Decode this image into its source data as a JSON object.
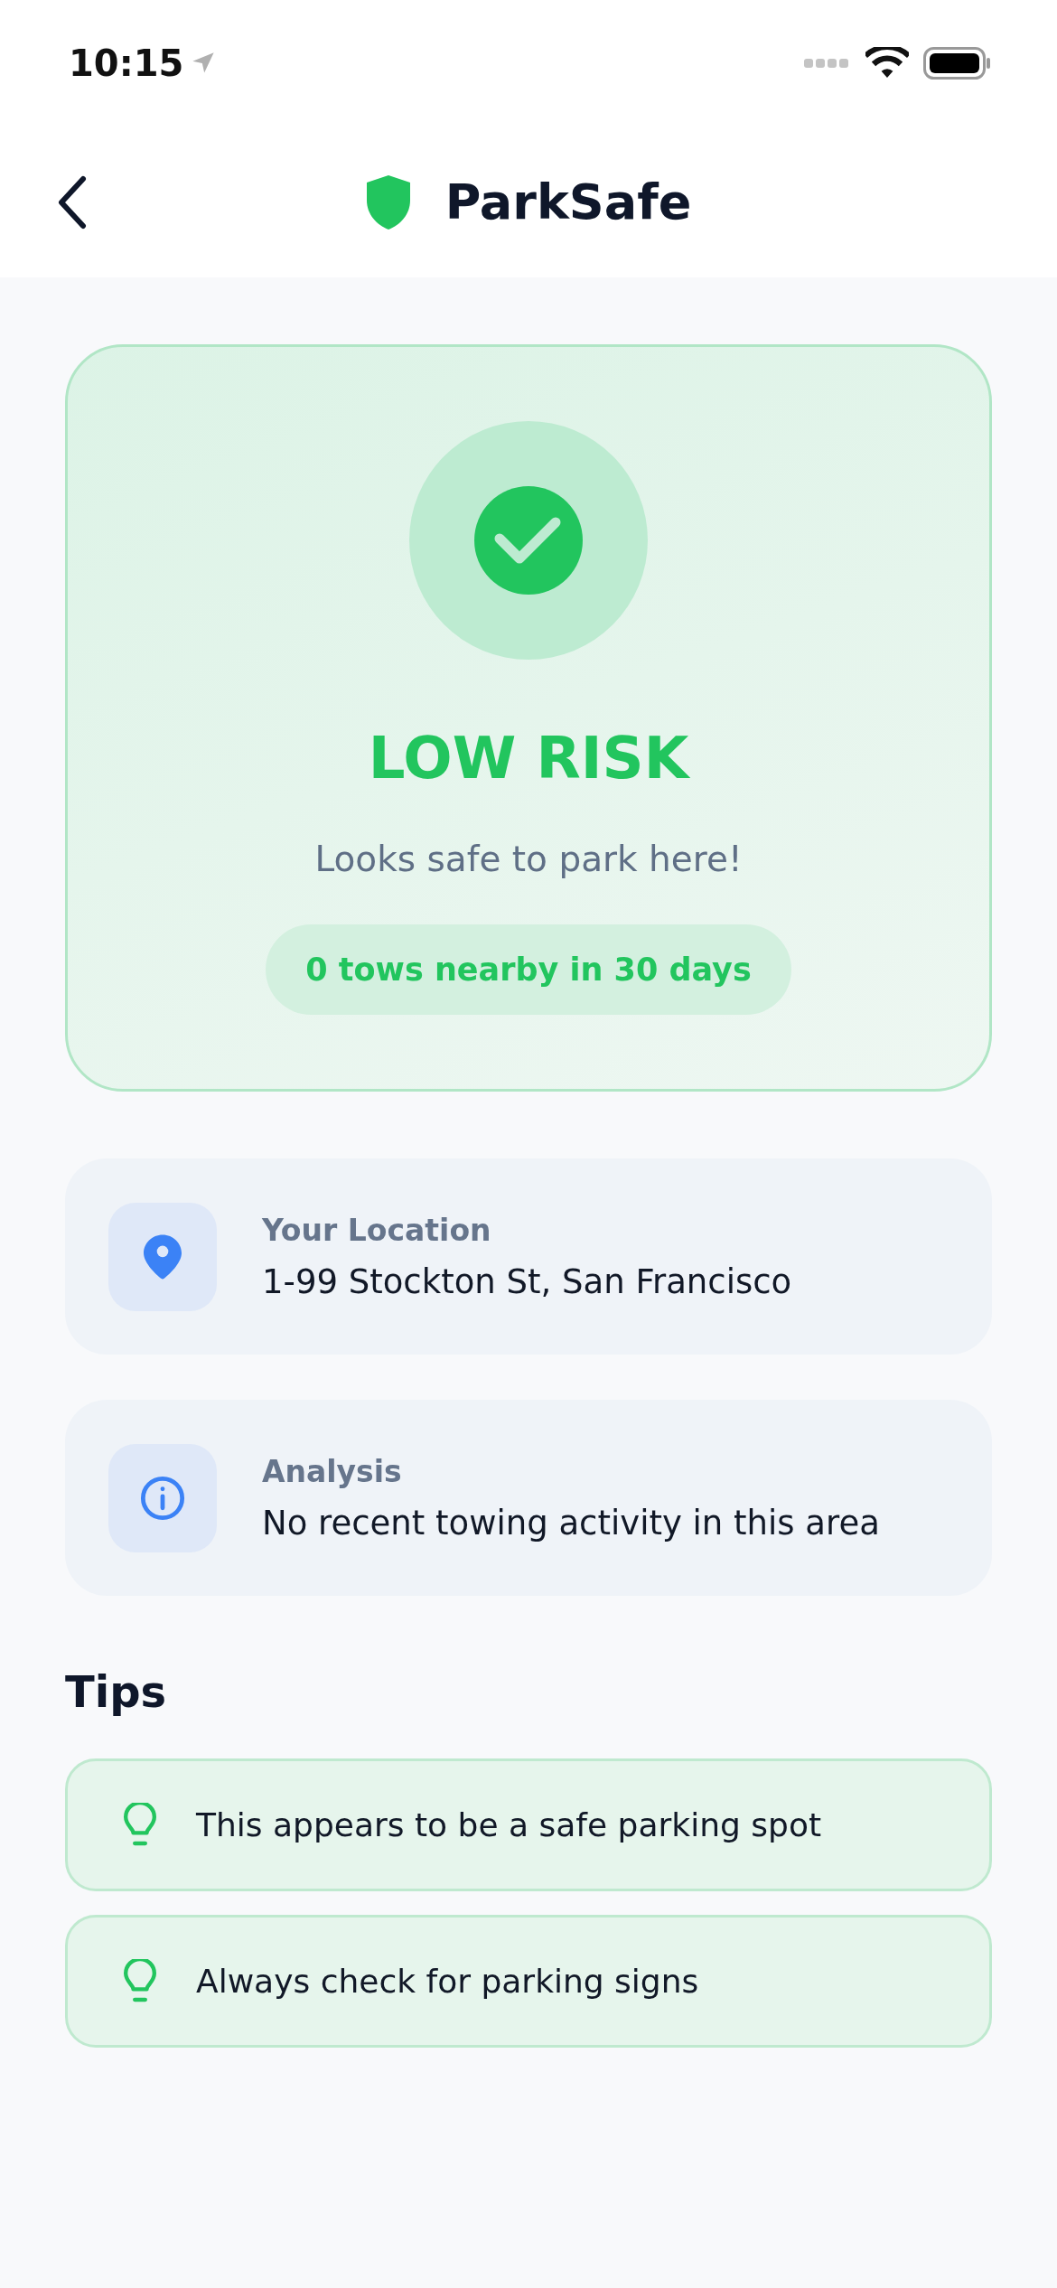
{
  "status_bar": {
    "time": "10:15"
  },
  "header": {
    "title": "ParkSafe"
  },
  "risk": {
    "kind": "low",
    "label": "LOW RISK",
    "message": "Looks safe to park here!",
    "badge": "0 tows nearby in 30 days"
  },
  "info_cards": [
    {
      "kind": "location",
      "label": "Your Location",
      "value": "1-99 Stockton St, San Francisco"
    },
    {
      "kind": "info",
      "label": "Analysis",
      "value": "No recent towing activity in this area"
    }
  ],
  "tips": {
    "title": "Tips",
    "items": [
      {
        "text": "This appears to be a safe parking spot"
      },
      {
        "text": "Always check for parking signs"
      }
    ]
  }
}
